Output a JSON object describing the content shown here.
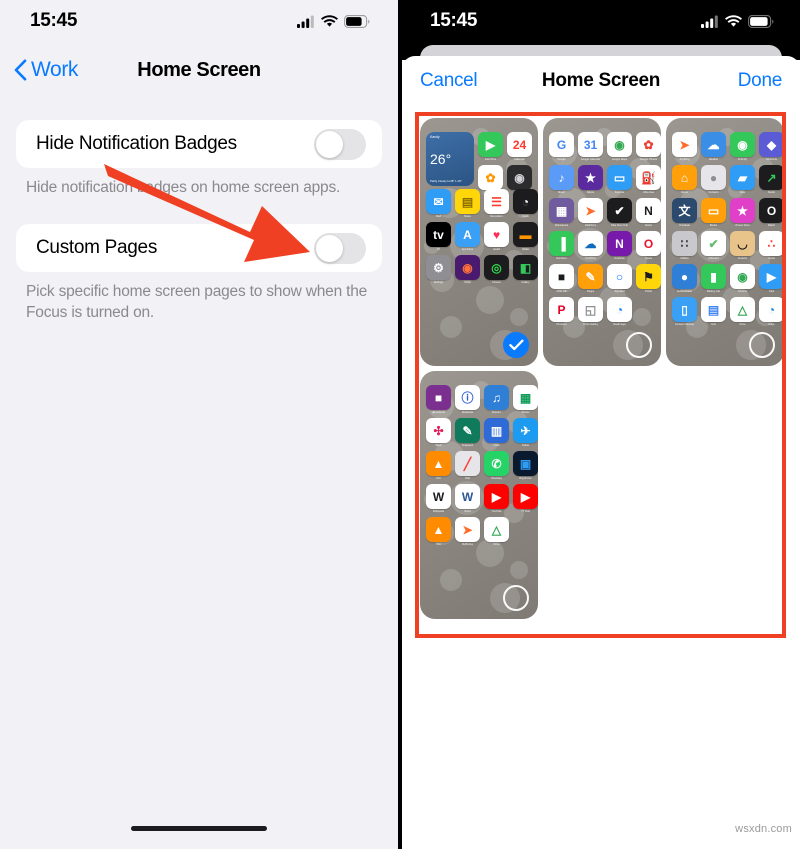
{
  "left": {
    "status": {
      "time": "15:45",
      "signal_icon": "cellular-bars-icon",
      "wifi_icon": "wifi-icon",
      "battery_icon": "battery-icon"
    },
    "nav": {
      "back_label": "Work",
      "back_icon": "chevron-left-icon",
      "title": "Home Screen"
    },
    "rows": [
      {
        "label": "Hide Notification Badges",
        "toggle_state": "off",
        "footnote": "Hide notification badges on home screen apps."
      },
      {
        "label": "Custom Pages",
        "toggle_state": "off",
        "footnote": "Pick specific home screen pages to show when the Focus is turned on."
      }
    ],
    "annotation": {
      "type": "arrow",
      "color": "#ef4023",
      "points_to": "custom-pages-toggle"
    },
    "home_indicator": "home-indicator"
  },
  "right": {
    "status": {
      "time": "15:45",
      "signal_icon": "cellular-bars-icon",
      "wifi_icon": "wifi-icon",
      "battery_icon": "battery-icon"
    },
    "sheet": {
      "cancel_label": "Cancel",
      "title": "Home Screen",
      "done_label": "Done"
    },
    "annotation": {
      "type": "rectangle",
      "color": "#ef4023"
    },
    "pages": [
      {
        "id": "page-1",
        "selected": true,
        "widget": {
          "city": "Kandy",
          "temp": "26°",
          "condition": "Partly Cloudy",
          "hilo": "H:28° L:19°"
        },
        "apps": [
          [
            {
              "name": "FaceTime",
              "glyph": "▶",
              "bg": "#34c759",
              "fg": "#ffffff",
              "radius": "6px"
            },
            {
              "name": "Calendar",
              "glyph": "24",
              "bg": "#ffffff",
              "fg": "#ff3b30",
              "radius": "6px"
            }
          ],
          [
            {
              "name": "Photos",
              "glyph": "✿",
              "bg": "#ffffff",
              "fg": "#ff9500",
              "radius": "6px"
            },
            {
              "name": "Camera",
              "glyph": "◉",
              "bg": "#2c2c2e",
              "fg": "#d1d1d6",
              "radius": "6px"
            }
          ],
          [
            {
              "name": "Mail",
              "glyph": "✉",
              "bg": "#2f9cf5",
              "fg": "#ffffff",
              "radius": "6px"
            },
            {
              "name": "Notes",
              "glyph": "▤",
              "bg": "#ffd60a",
              "fg": "#8a6d00",
              "radius": "6px"
            },
            {
              "name": "Reminders",
              "glyph": "☰",
              "bg": "#ffffff",
              "fg": "#ff3b30",
              "radius": "6px"
            },
            {
              "name": "Clock",
              "glyph": "◔",
              "bg": "#1c1c1e",
              "fg": "#ffffff",
              "radius": "6px"
            }
          ],
          [
            {
              "name": "TV",
              "glyph": "tv",
              "bg": "#000000",
              "fg": "#ffffff",
              "radius": "6px"
            },
            {
              "name": "App Store",
              "glyph": "A",
              "bg": "#3aa0f5",
              "fg": "#ffffff",
              "radius": "6px"
            },
            {
              "name": "Health",
              "glyph": "♥",
              "bg": "#ffffff",
              "fg": "#ff2d55",
              "radius": "6px"
            },
            {
              "name": "Wallet",
              "glyph": "▬",
              "bg": "#1c1c1e",
              "fg": "#ff9500",
              "radius": "6px"
            }
          ],
          [
            {
              "name": "Settings",
              "glyph": "⚙",
              "bg": "#8e8e93",
              "fg": "#ffffff",
              "radius": "6px"
            },
            {
              "name": "Firefox",
              "glyph": "◉",
              "bg": "#4a1a6e",
              "fg": "#ff7139",
              "radius": "6px"
            },
            {
              "name": "Fitness",
              "glyph": "◎",
              "bg": "#1c1c1e",
              "fg": "#32d74b",
              "radius": "6px"
            },
            {
              "name": "Gallery",
              "glyph": "◧",
              "bg": "#1c1c1e",
              "fg": "#34c759",
              "radius": "6px"
            }
          ]
        ]
      },
      {
        "id": "page-2",
        "selected": false,
        "apps": [
          [
            {
              "name": "Google",
              "glyph": "G",
              "bg": "#ffffff",
              "fg": "#4285f4",
              "radius": "6px"
            },
            {
              "name": "Google Calendar",
              "glyph": "31",
              "bg": "#ffffff",
              "fg": "#4285f4",
              "radius": "6px"
            },
            {
              "name": "Google Maps",
              "glyph": "◉",
              "bg": "#ffffff",
              "fg": "#34a853",
              "radius": "6px"
            },
            {
              "name": "Google Photos",
              "glyph": "✿",
              "bg": "#ffffff",
              "fg": "#ea4335",
              "radius": "6px"
            }
          ],
          [
            {
              "name": "Music",
              "glyph": "♪",
              "bg": "#5b9bf8",
              "fg": "#ffffff",
              "radius": "6px"
            },
            {
              "name": "iMovie",
              "glyph": "★",
              "bg": "#5b2a9e",
              "fg": "#ffffff",
              "radius": "6px"
            },
            {
              "name": "Keynote",
              "glyph": "▭",
              "bg": "#2f9cf5",
              "fg": "#ffffff",
              "radius": "6px"
            },
            {
              "name": "Ultra Gas",
              "glyph": "⛽",
              "bg": "#ffffff",
              "fg": "#2b7a3f",
              "radius": "6px"
            }
          ],
          [
            {
              "name": "Mainstreets",
              "glyph": "▦",
              "bg": "#6f5b9e",
              "fg": "#ffffff",
              "radius": "6px"
            },
            {
              "name": "Mailchimp",
              "glyph": "➤",
              "bg": "#ffffff",
              "fg": "#ff6b2c",
              "radius": "6px"
            },
            {
              "name": "Nike Run Club",
              "glyph": "✔",
              "bg": "#1c1c1e",
              "fg": "#ffffff",
              "radius": "6px"
            },
            {
              "name": "Notion",
              "glyph": "N",
              "bg": "#ffffff",
              "fg": "#1c1c1e",
              "radius": "6px"
            }
          ],
          [
            {
              "name": "Numbers",
              "glyph": "▐",
              "bg": "#34c759",
              "fg": "#ffffff",
              "radius": "6px"
            },
            {
              "name": "OneDrive",
              "glyph": "☁",
              "bg": "#ffffff",
              "fg": "#0f6cbd",
              "radius": "6px"
            },
            {
              "name": "OneNote",
              "glyph": "N",
              "bg": "#7719aa",
              "fg": "#ffffff",
              "radius": "6px"
            },
            {
              "name": "Opera",
              "glyph": "O",
              "bg": "#ffffff",
              "fg": "#e8132a",
              "radius": "6px"
            }
          ],
          [
            {
              "name": "Otter CR",
              "glyph": "■",
              "bg": "#ffffff",
              "fg": "#1c1c1e",
              "radius": "6px"
            },
            {
              "name": "Pages",
              "glyph": "✎",
              "bg": "#ff9f0a",
              "fg": "#ffffff",
              "radius": "6px"
            },
            {
              "name": "Signaled",
              "glyph": "○",
              "bg": "#ffffff",
              "fg": "#0a7aff",
              "radius": "6px"
            },
            {
              "name": "Pickle",
              "glyph": "⚑",
              "bg": "#ffd60a",
              "fg": "#1c1c1e",
              "radius": "6px"
            }
          ],
          [
            {
              "name": "Pinterest",
              "glyph": "P",
              "bg": "#ffffff",
              "fg": "#e60023",
              "radius": "6px"
            },
            {
              "name": "Photo Gallery",
              "glyph": "◱",
              "bg": "#ffffff",
              "fg": "#8e8e93",
              "radius": "6px"
            },
            {
              "name": "RealImage",
              "glyph": "◔",
              "bg": "#ffffff",
              "fg": "#0a7aff",
              "radius": "6px"
            }
          ]
        ]
      },
      {
        "id": "page-3",
        "selected": false,
        "apps": [
          [
            {
              "name": "Anything",
              "glyph": "➤",
              "bg": "#ffffff",
              "fg": "#ff6b2c",
              "radius": "6px"
            },
            {
              "name": "Weather",
              "glyph": "☁",
              "bg": "#3a8ee6",
              "fg": "#ffffff",
              "radius": "6px"
            },
            {
              "name": "Find My",
              "glyph": "◉",
              "bg": "#34c759",
              "fg": "#ffffff",
              "radius": "6px"
            },
            {
              "name": "Shortcuts",
              "glyph": "◆",
              "bg": "#5b5bd6",
              "fg": "#ffffff",
              "radius": "6px"
            }
          ],
          [
            {
              "name": "Home",
              "glyph": "⌂",
              "bg": "#ff9f0a",
              "fg": "#ffffff",
              "radius": "6px"
            },
            {
              "name": "Contacts",
              "glyph": "●",
              "bg": "#e5e5ea",
              "fg": "#8e8e93",
              "radius": "6px"
            },
            {
              "name": "Files",
              "glyph": "▰",
              "bg": "#2f9cf5",
              "fg": "#ffffff",
              "radius": "6px"
            },
            {
              "name": "Stocks",
              "glyph": "↗",
              "bg": "#1c1c1e",
              "fg": "#34c759",
              "radius": "6px"
            }
          ],
          [
            {
              "name": "Translate",
              "glyph": "文",
              "bg": "#2c4a6e",
              "fg": "#ffffff",
              "radius": "6px"
            },
            {
              "name": "Books",
              "glyph": "▭",
              "bg": "#ff9f0a",
              "fg": "#ffffff",
              "radius": "6px"
            },
            {
              "name": "iTunes Store",
              "glyph": "★",
              "bg": "#e040c8",
              "fg": "#ffffff",
              "radius": "6px"
            },
            {
              "name": "Watch",
              "glyph": "O",
              "bg": "#1c1c1e",
              "fg": "#ffffff",
              "radius": "6px"
            }
          ],
          [
            {
              "name": "Utilities",
              "glyph": "∷",
              "bg": "#c8c8cd",
              "fg": "#3a3a3c",
              "radius": "6px"
            },
            {
              "name": "AdGuard",
              "glyph": "✔",
              "bg": "#ffffff",
              "fg": "#68bc71",
              "radius": "6px"
            },
            {
              "name": "Amazon",
              "glyph": "◡",
              "bg": "#e8c48a",
              "fg": "#1c1c1e",
              "radius": "6px"
            },
            {
              "name": "Avast",
              "glyph": "∴",
              "bg": "#ffffff",
              "fg": "#ff3b30",
              "radius": "6px"
            }
          ],
          [
            {
              "name": "Authenticator",
              "glyph": "●",
              "bg": "#2f7fd6",
              "fg": "#ffffff",
              "radius": "6px"
            },
            {
              "name": "Battery Life",
              "glyph": "▮",
              "bg": "#34c759",
              "fg": "#ffffff",
              "radius": "6px"
            },
            {
              "name": "Chrome",
              "glyph": "◉",
              "bg": "#ffffff",
              "fg": "#34a853",
              "radius": "6px"
            },
            {
              "name": "Ciba",
              "glyph": "▶",
              "bg": "#2f9cf5",
              "fg": "#ffffff",
              "radius": "6px"
            }
          ],
          [
            {
              "name": "Contact Cleanup",
              "glyph": "▯",
              "bg": "#3aa0f5",
              "fg": "#ffffff",
              "radius": "6px"
            },
            {
              "name": "Docs",
              "glyph": "▤",
              "bg": "#ffffff",
              "fg": "#4285f4",
              "radius": "6px"
            },
            {
              "name": "Drive",
              "glyph": "△",
              "bg": "#ffffff",
              "fg": "#34a853",
              "radius": "6px"
            },
            {
              "name": "Edge",
              "glyph": "◔",
              "bg": "#ffffff",
              "fg": "#0f7bd6",
              "radius": "6px"
            }
          ]
        ]
      },
      {
        "id": "page-4",
        "selected": false,
        "apps": [
          [
            {
              "name": "gReadwork",
              "glyph": "■",
              "bg": "#7b2f8e",
              "fg": "#ffffff",
              "radius": "6px"
            },
            {
              "name": "Readwise",
              "glyph": "ⓘ",
              "bg": "#ffffff",
              "fg": "#2f5bd6",
              "radius": "6px"
            },
            {
              "name": "Shazam",
              "glyph": "♫",
              "bg": "#2f7fd6",
              "fg": "#ffffff",
              "radius": "6px"
            },
            {
              "name": "Sheets",
              "glyph": "▦",
              "bg": "#ffffff",
              "fg": "#0f9d58",
              "radius": "6px"
            }
          ],
          [
            {
              "name": "Slack",
              "glyph": "✣",
              "bg": "#ffffff",
              "fg": "#e01e5a",
              "radius": "6px"
            },
            {
              "name": "Snapseed",
              "glyph": "✎",
              "bg": "#0f7a5c",
              "fg": "#ffffff",
              "radius": "6px"
            },
            {
              "name": "Trello",
              "glyph": "▥",
              "bg": "#2f6bd6",
              "fg": "#ffffff",
              "radius": "6px"
            },
            {
              "name": "Twitter",
              "glyph": "✈",
              "bg": "#1d9bf0",
              "fg": "#ffffff",
              "radius": "6px"
            }
          ],
          [
            {
              "name": "VLC",
              "glyph": "▲",
              "bg": "#ff8c00",
              "fg": "#ffffff",
              "radius": "6px"
            },
            {
              "name": "Vlab",
              "glyph": "╱",
              "bg": "#e5e5ea",
              "fg": "#ff3b30",
              "radius": "6px"
            },
            {
              "name": "WhatsApp",
              "glyph": "✆",
              "bg": "#25d366",
              "fg": "#ffffff",
              "radius": "6px"
            },
            {
              "name": "Brightness",
              "glyph": "▣",
              "bg": "#0a1a2e",
              "fg": "#2f9cf5",
              "radius": "6px"
            }
          ],
          [
            {
              "name": "Wikipedia",
              "glyph": "W",
              "bg": "#ffffff",
              "fg": "#1c1c1e",
              "radius": "6px"
            },
            {
              "name": "Word",
              "glyph": "W",
              "bg": "#ffffff",
              "fg": "#2b5797",
              "radius": "6px"
            },
            {
              "name": "YouTube",
              "glyph": "▶",
              "bg": "#ff0000",
              "fg": "#ffffff",
              "radius": "6px"
            },
            {
              "name": "YT Kids",
              "glyph": "▶",
              "bg": "#ff0000",
              "fg": "#ffffff",
              "radius": "6px"
            }
          ],
          [
            {
              "name": "VLC",
              "glyph": "▲",
              "bg": "#ff8c00",
              "fg": "#ffffff",
              "radius": "6px"
            },
            {
              "name": "MyBishop",
              "glyph": "➤",
              "bg": "#ffffff",
              "fg": "#ff6b2c",
              "radius": "6px"
            },
            {
              "name": "Drive",
              "glyph": "△",
              "bg": "#ffffff",
              "fg": "#34a853",
              "radius": "6px"
            }
          ]
        ]
      }
    ],
    "home_indicator": "home-indicator"
  },
  "watermark": "wsxdn.com"
}
